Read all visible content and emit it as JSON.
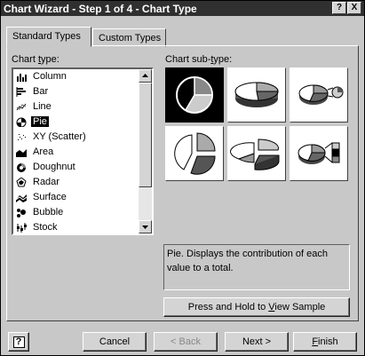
{
  "window": {
    "title": "Chart Wizard - Step 1 of 4 - Chart Type",
    "help_button": "?",
    "close_button": "X"
  },
  "tabs": [
    {
      "label": "Standard Types",
      "active": true
    },
    {
      "label": "Custom Types",
      "active": false
    }
  ],
  "chart_type": {
    "label_pre": "Chart ",
    "label_key": "t",
    "label_post": "ype:",
    "items": [
      {
        "label": "Column",
        "icon": "column-icon"
      },
      {
        "label": "Bar",
        "icon": "bar-icon"
      },
      {
        "label": "Line",
        "icon": "line-icon"
      },
      {
        "label": "Pie",
        "icon": "pie-icon",
        "selected": true
      },
      {
        "label": "XY (Scatter)",
        "icon": "scatter-icon"
      },
      {
        "label": "Area",
        "icon": "area-icon"
      },
      {
        "label": "Doughnut",
        "icon": "doughnut-icon"
      },
      {
        "label": "Radar",
        "icon": "radar-icon"
      },
      {
        "label": "Surface",
        "icon": "surface-icon"
      },
      {
        "label": "Bubble",
        "icon": "bubble-icon"
      },
      {
        "label": "Stock",
        "icon": "stock-icon"
      }
    ]
  },
  "sub_type": {
    "label_pre": "Chart sub-",
    "label_key": "t",
    "label_post": "ype:",
    "items": [
      {
        "icon": "pie-subtype-icon",
        "selected": true
      },
      {
        "icon": "pie-3d-subtype-icon"
      },
      {
        "icon": "pie-of-pie-subtype-icon"
      },
      {
        "icon": "exploded-pie-subtype-icon"
      },
      {
        "icon": "exploded-pie-3d-subtype-icon"
      },
      {
        "icon": "bar-of-pie-subtype-icon"
      }
    ]
  },
  "description": "Pie. Displays the contribution of each value to a total.",
  "sample_button": {
    "pre": "Press and Hold to ",
    "key": "V",
    "post": "iew Sample"
  },
  "footer": {
    "help": "?",
    "cancel": "Cancel",
    "back": "< Back",
    "next": "Next >",
    "finish_key": "F",
    "finish_rest": "inish"
  }
}
